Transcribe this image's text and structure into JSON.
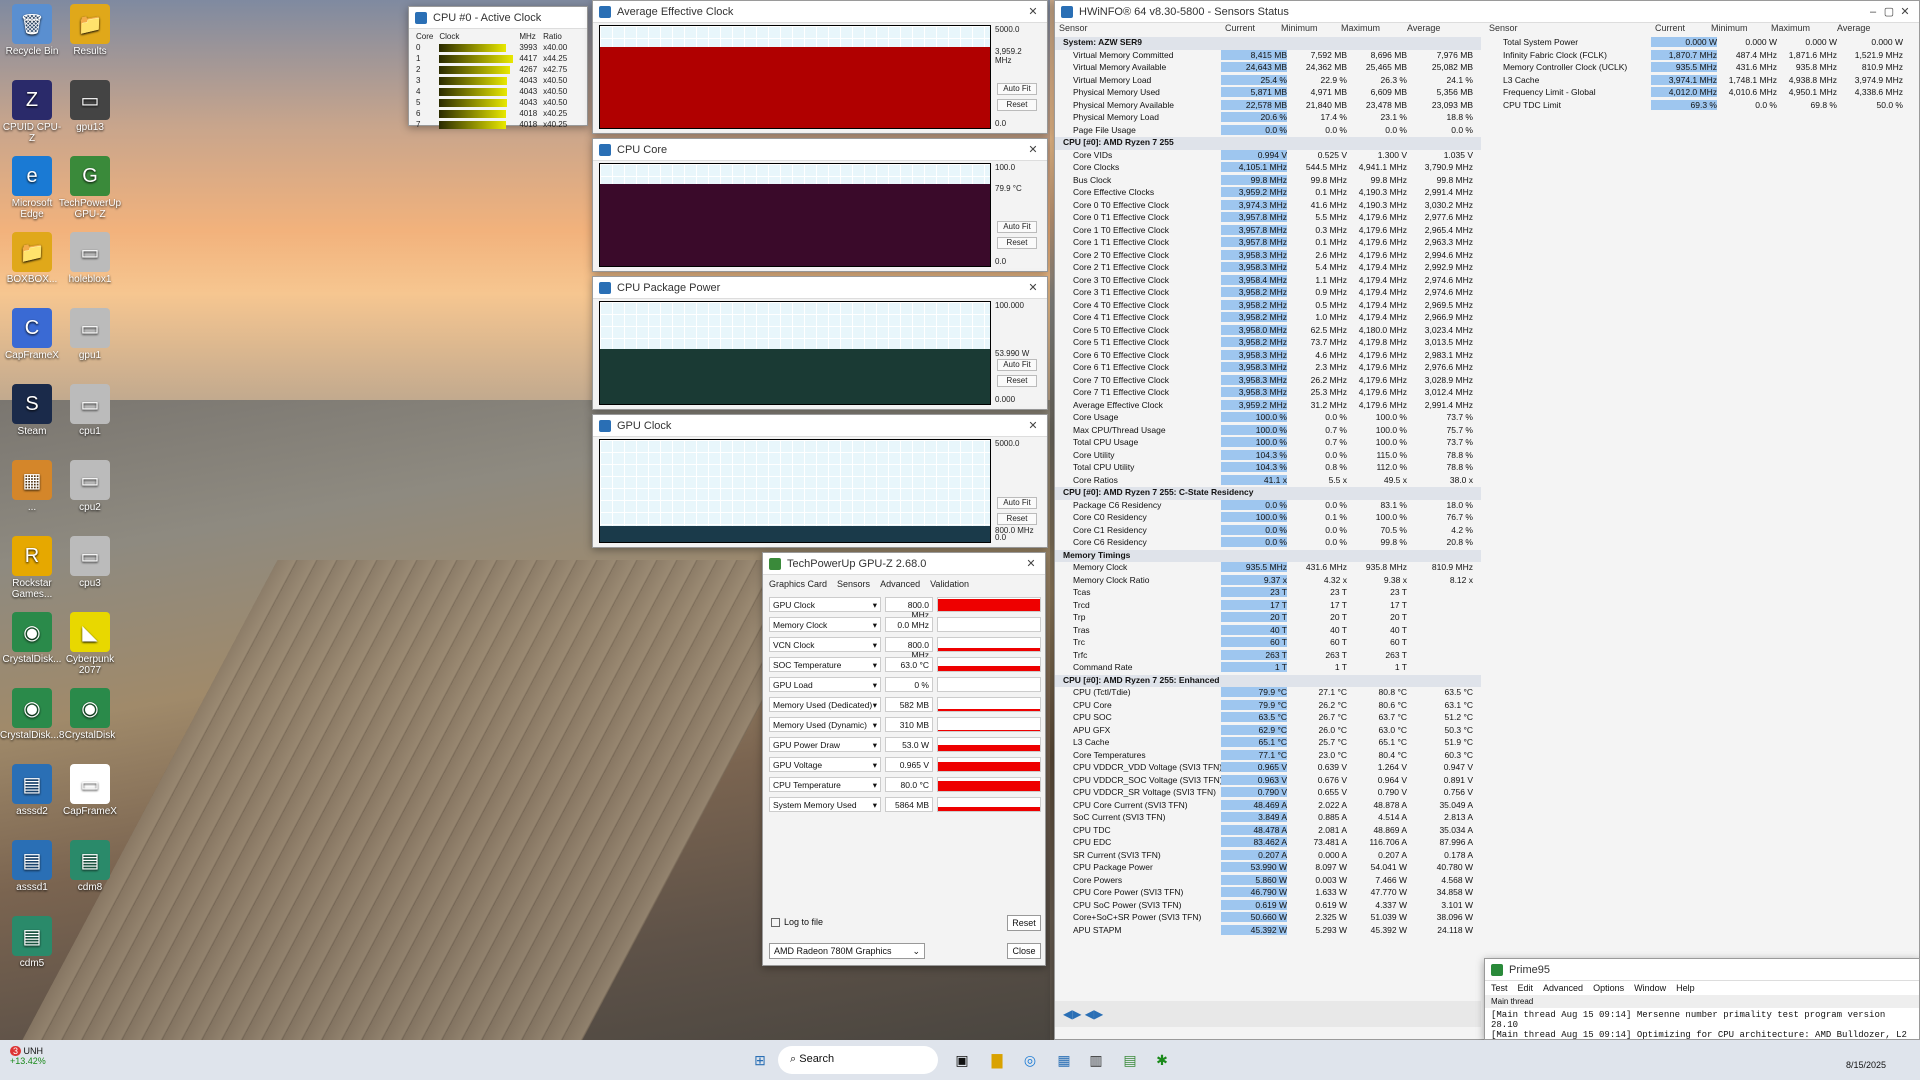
{
  "desktop": {
    "icons": [
      {
        "label": "Recycle Bin",
        "icon": "recycle-bin-icon",
        "glyph": "🗑"
      },
      {
        "label": "Results",
        "icon": "folder-icon",
        "glyph": "📁"
      },
      {
        "label": "CPUID CPU-Z",
        "icon": "cpuz-icon",
        "glyph": "Z"
      },
      {
        "label": "gpu13",
        "icon": "file-icon",
        "glyph": "▭"
      },
      {
        "label": "Microsoft Edge",
        "icon": "edge-icon",
        "glyph": "e"
      },
      {
        "label": "TechPowerUp GPU-Z",
        "icon": "gpuz-icon",
        "glyph": "G"
      },
      {
        "label": "BOXBOX...",
        "icon": "folder-icon",
        "glyph": "📁"
      },
      {
        "label": "holeblox1",
        "icon": "file-icon",
        "glyph": "▭"
      },
      {
        "label": "CapFrameX",
        "icon": "capframex-icon",
        "glyph": "C"
      },
      {
        "label": "gpu1",
        "icon": "file-icon",
        "glyph": "▭"
      },
      {
        "label": "Steam",
        "icon": "steam-icon",
        "glyph": "S"
      },
      {
        "label": "cpu1",
        "icon": "file-icon",
        "glyph": "▭"
      },
      {
        "label": "...",
        "icon": "app-icon",
        "glyph": "▦"
      },
      {
        "label": "cpu2",
        "icon": "file-icon",
        "glyph": "▭"
      },
      {
        "label": "Rockstar Games...",
        "icon": "rockstar-icon",
        "glyph": "R"
      },
      {
        "label": "cpu3",
        "icon": "file-icon",
        "glyph": "▭"
      },
      {
        "label": "CrystalDisk...",
        "icon": "crystaldisk-icon",
        "glyph": "◉"
      },
      {
        "label": "Cyberpunk 2077",
        "icon": "cyberpunk-icon",
        "glyph": "◣"
      },
      {
        "label": "CrystalDisk...8",
        "icon": "crystaldisk-icon",
        "glyph": "◉"
      },
      {
        "label": "CrystalDisk",
        "icon": "crystaldisk-icon",
        "glyph": "◉"
      },
      {
        "label": "asssd2",
        "icon": "asssd-icon",
        "glyph": "▤"
      },
      {
        "label": "CapFrameX",
        "icon": "file-icon",
        "glyph": "▭"
      },
      {
        "label": "asssd1",
        "icon": "asssd-icon",
        "glyph": "▤"
      },
      {
        "label": "cdm8",
        "icon": "cdm-icon",
        "glyph": "▤"
      },
      {
        "label": "cdm5",
        "icon": "cdm-icon",
        "glyph": "▤"
      }
    ]
  },
  "active_clock": {
    "title": "CPU #0 - Active Clock",
    "headers": [
      "Core",
      "Clock",
      "MHz",
      "Ratio"
    ],
    "rows": [
      [
        "0",
        "3993",
        "x40.00"
      ],
      [
        "1",
        "4417",
        "x44.25"
      ],
      [
        "2",
        "4267",
        "x42.75"
      ],
      [
        "3",
        "4043",
        "x40.50"
      ],
      [
        "4",
        "4043",
        "x40.50"
      ],
      [
        "5",
        "4043",
        "x40.50"
      ],
      [
        "6",
        "4018",
        "x40.25"
      ],
      [
        "7",
        "4018",
        "x40.25"
      ]
    ],
    "levels": [
      0.9,
      1.0,
      0.96,
      0.91,
      0.91,
      0.91,
      0.9,
      0.9
    ]
  },
  "graphs": [
    {
      "title": "Average Effective Clock",
      "max": "5000.0",
      "cur": "3,959.2 MHz",
      "min": "0.0",
      "fill": "#b00000",
      "level": 0.79
    },
    {
      "title": "CPU Core",
      "max": "100.0",
      "cur": "79.9 °C",
      "min": "0.0",
      "fill": "#3a0a2a",
      "level": 0.8
    },
    {
      "title": "CPU Package Power",
      "max": "100.000",
      "cur": "53.990 W",
      "min": "0.000",
      "fill": "#1a3a34",
      "level": 0.54
    },
    {
      "title": "GPU Clock",
      "max": "5000.0",
      "cur": "800.0 MHz",
      "min": "0.0",
      "fill": "#1a3a4a",
      "level": 0.16
    }
  ],
  "graph_buttons": {
    "autofit": "Auto Fit",
    "reset": "Reset"
  },
  "gpuz": {
    "title": "TechPowerUp GPU-Z 2.68.0",
    "tabs": [
      "Graphics Card",
      "Sensors",
      "Advanced",
      "Validation"
    ],
    "rows": [
      {
        "name": "GPU Clock",
        "value": "800.0 MHz",
        "level": 0.9
      },
      {
        "name": "Memory Clock",
        "value": "0.0 MHz",
        "level": 0.0
      },
      {
        "name": "VCN Clock",
        "value": "800.0 MHz",
        "level": 0.2
      },
      {
        "name": "SOC Temperature",
        "value": "63.0 °C",
        "level": 0.4
      },
      {
        "name": "GPU Load",
        "value": "0 %",
        "level": 0.0
      },
      {
        "name": "Memory Used (Dedicated)",
        "value": "582 MB",
        "level": 0.15
      },
      {
        "name": "Memory Used (Dynamic)",
        "value": "310 MB",
        "level": 0.1
      },
      {
        "name": "GPU Power Draw",
        "value": "53.0 W",
        "level": 0.5
      },
      {
        "name": "GPU Voltage",
        "value": "0.965 V",
        "level": 0.7
      },
      {
        "name": "CPU Temperature",
        "value": "80.0 °C",
        "level": 0.8
      },
      {
        "name": "System Memory Used",
        "value": "5864 MB",
        "level": 0.3
      }
    ],
    "log": "Log to file",
    "reset": "Reset",
    "device": "AMD Radeon 780M Graphics",
    "close": "Close"
  },
  "hwinfo": {
    "title": "HWiNFO® 64 v8.30-5800 - Sensors Status",
    "headers": [
      "Sensor",
      "Current",
      "Minimum",
      "Maximum",
      "Average"
    ],
    "left": [
      {
        "sec": "System: AZW SER9"
      },
      [
        "Virtual Memory Committed",
        "8,415 MB",
        "7,592 MB",
        "8,696 MB",
        "7,976 MB"
      ],
      [
        "Virtual Memory Available",
        "24,643 MB",
        "24,362 MB",
        "25,465 MB",
        "25,082 MB"
      ],
      [
        "Virtual Memory Load",
        "25.4 %",
        "22.9 %",
        "26.3 %",
        "24.1 %"
      ],
      [
        "Physical Memory Used",
        "5,871 MB",
        "4,971 MB",
        "6,609 MB",
        "5,356 MB"
      ],
      [
        "Physical Memory Available",
        "22,578 MB",
        "21,840 MB",
        "23,478 MB",
        "23,093 MB"
      ],
      [
        "Physical Memory Load",
        "20.6 %",
        "17.4 %",
        "23.1 %",
        "18.8 %"
      ],
      [
        "Page File Usage",
        "0.0 %",
        "0.0 %",
        "0.0 %",
        "0.0 %"
      ],
      {
        "sec": "CPU [#0]: AMD Ryzen 7 255"
      },
      [
        "Core VIDs",
        "0.994 V",
        "0.525 V",
        "1.300 V",
        "1.035 V"
      ],
      [
        "Core Clocks",
        "4,105.1 MHz",
        "544.5 MHz",
        "4,941.1 MHz",
        "3,790.9 MHz"
      ],
      [
        "Bus Clock",
        "99.8 MHz",
        "99.8 MHz",
        "99.8 MHz",
        "99.8 MHz"
      ],
      [
        "Core Effective Clocks",
        "3,959.2 MHz",
        "0.1 MHz",
        "4,190.3 MHz",
        "2,991.4 MHz"
      ],
      [
        "Core 0 T0 Effective Clock",
        "3,974.3 MHz",
        "41.6 MHz",
        "4,190.3 MHz",
        "3,030.2 MHz"
      ],
      [
        "Core 0 T1 Effective Clock",
        "3,957.8 MHz",
        "5.5 MHz",
        "4,179.6 MHz",
        "2,977.6 MHz"
      ],
      [
        "Core 1 T0 Effective Clock",
        "3,957.8 MHz",
        "0.3 MHz",
        "4,179.6 MHz",
        "2,965.4 MHz"
      ],
      [
        "Core 1 T1 Effective Clock",
        "3,957.8 MHz",
        "0.1 MHz",
        "4,179.6 MHz",
        "2,963.3 MHz"
      ],
      [
        "Core 2 T0 Effective Clock",
        "3,958.3 MHz",
        "2.6 MHz",
        "4,179.6 MHz",
        "2,994.6 MHz"
      ],
      [
        "Core 2 T1 Effective Clock",
        "3,958.3 MHz",
        "5.4 MHz",
        "4,179.4 MHz",
        "2,992.9 MHz"
      ],
      [
        "Core 3 T0 Effective Clock",
        "3,958.4 MHz",
        "1.1 MHz",
        "4,179.4 MHz",
        "2,974.6 MHz"
      ],
      [
        "Core 3 T1 Effective Clock",
        "3,958.2 MHz",
        "0.9 MHz",
        "4,179.4 MHz",
        "2,974.6 MHz"
      ],
      [
        "Core 4 T0 Effective Clock",
        "3,958.2 MHz",
        "0.5 MHz",
        "4,179.4 MHz",
        "2,969.5 MHz"
      ],
      [
        "Core 4 T1 Effective Clock",
        "3,958.2 MHz",
        "1.0 MHz",
        "4,179.4 MHz",
        "2,966.9 MHz"
      ],
      [
        "Core 5 T0 Effective Clock",
        "3,958.0 MHz",
        "62.5 MHz",
        "4,180.0 MHz",
        "3,023.4 MHz"
      ],
      [
        "Core 5 T1 Effective Clock",
        "3,958.2 MHz",
        "73.7 MHz",
        "4,179.8 MHz",
        "3,013.5 MHz"
      ],
      [
        "Core 6 T0 Effective Clock",
        "3,958.3 MHz",
        "4.6 MHz",
        "4,179.6 MHz",
        "2,983.1 MHz"
      ],
      [
        "Core 6 T1 Effective Clock",
        "3,958.3 MHz",
        "2.3 MHz",
        "4,179.6 MHz",
        "2,976.6 MHz"
      ],
      [
        "Core 7 T0 Effective Clock",
        "3,958.3 MHz",
        "26.2 MHz",
        "4,179.6 MHz",
        "3,028.9 MHz"
      ],
      [
        "Core 7 T1 Effective Clock",
        "3,958.3 MHz",
        "25.3 MHz",
        "4,179.6 MHz",
        "3,012.4 MHz"
      ],
      [
        "Average Effective Clock",
        "3,959.2 MHz",
        "31.2 MHz",
        "4,179.6 MHz",
        "2,991.4 MHz"
      ],
      [
        "Core Usage",
        "100.0 %",
        "0.0 %",
        "100.0 %",
        "73.7 %"
      ],
      [
        "Max CPU/Thread Usage",
        "100.0 %",
        "0.7 %",
        "100.0 %",
        "75.7 %"
      ],
      [
        "Total CPU Usage",
        "100.0 %",
        "0.7 %",
        "100.0 %",
        "73.7 %"
      ],
      [
        "Core Utility",
        "104.3 %",
        "0.0 %",
        "115.0 %",
        "78.8 %"
      ],
      [
        "Total CPU Utility",
        "104.3 %",
        "0.8 %",
        "112.0 %",
        "78.8 %"
      ],
      [
        "Core Ratios",
        "41.1 x",
        "5.5 x",
        "49.5 x",
        "38.0 x"
      ],
      {
        "sec": "CPU [#0]: AMD Ryzen 7 255: C-State Residency"
      },
      [
        "Package C6 Residency",
        "0.0 %",
        "0.0 %",
        "83.1 %",
        "18.0 %"
      ],
      [
        "Core C0 Residency",
        "100.0 %",
        "0.1 %",
        "100.0 %",
        "76.7 %"
      ],
      [
        "Core C1 Residency",
        "0.0 %",
        "0.0 %",
        "70.5 %",
        "4.2 %"
      ],
      [
        "Core C6 Residency",
        "0.0 %",
        "0.0 %",
        "99.8 %",
        "20.8 %"
      ],
      {
        "sec": "Memory Timings"
      },
      [
        "Memory Clock",
        "935.5 MHz",
        "431.6 MHz",
        "935.8 MHz",
        "810.9 MHz"
      ],
      [
        "Memory Clock Ratio",
        "9.37 x",
        "4.32 x",
        "9.38 x",
        "8.12 x"
      ],
      [
        "Tcas",
        "23 T",
        "23 T",
        "23 T",
        ""
      ],
      [
        "Trcd",
        "17 T",
        "17 T",
        "17 T",
        ""
      ],
      [
        "Trp",
        "20 T",
        "20 T",
        "20 T",
        ""
      ],
      [
        "Tras",
        "40 T",
        "40 T",
        "40 T",
        ""
      ],
      [
        "Trc",
        "60 T",
        "60 T",
        "60 T",
        ""
      ],
      [
        "Trfc",
        "263 T",
        "263 T",
        "263 T",
        ""
      ],
      [
        "Command Rate",
        "1 T",
        "1 T",
        "1 T",
        ""
      ],
      {
        "sec": "CPU [#0]: AMD Ryzen 7 255: Enhanced"
      },
      [
        "CPU (Tctl/Tdie)",
        "79.9 °C",
        "27.1 °C",
        "80.8 °C",
        "63.5 °C"
      ],
      [
        "CPU Core",
        "79.9 °C",
        "26.2 °C",
        "80.6 °C",
        "63.1 °C"
      ],
      [
        "CPU SOC",
        "63.5 °C",
        "26.7 °C",
        "63.7 °C",
        "51.2 °C"
      ],
      [
        "APU GFX",
        "62.9 °C",
        "26.0 °C",
        "63.0 °C",
        "50.3 °C"
      ],
      [
        "L3 Cache",
        "65.1 °C",
        "25.7 °C",
        "65.1 °C",
        "51.9 °C"
      ],
      [
        "Core Temperatures",
        "77.1 °C",
        "23.0 °C",
        "80.4 °C",
        "60.3 °C"
      ],
      [
        "CPU VDDCR_VDD Voltage (SVI3 TFN)",
        "0.965 V",
        "0.639 V",
        "1.264 V",
        "0.947 V"
      ],
      [
        "CPU VDDCR_SOC Voltage (SVI3 TFN)",
        "0.963 V",
        "0.676 V",
        "0.964 V",
        "0.891 V"
      ],
      [
        "CPU VDDCR_SR Voltage (SVI3 TFN)",
        "0.790 V",
        "0.655 V",
        "0.790 V",
        "0.756 V"
      ],
      [
        "CPU Core Current (SVI3 TFN)",
        "48.469 A",
        "2.022 A",
        "48.878 A",
        "35.049 A"
      ],
      [
        "SoC Current (SVI3 TFN)",
        "3.849 A",
        "0.885 A",
        "4.514 A",
        "2.813 A"
      ],
      [
        "CPU TDC",
        "48.478 A",
        "2.081 A",
        "48.869 A",
        "35.034 A"
      ],
      [
        "CPU EDC",
        "83.462 A",
        "73.481 A",
        "116.706 A",
        "87.996 A"
      ],
      [
        "SR Current (SVI3 TFN)",
        "0.207 A",
        "0.000 A",
        "0.207 A",
        "0.178 A"
      ],
      [
        "CPU Package Power",
        "53.990 W",
        "8.097 W",
        "54.041 W",
        "40.780 W"
      ],
      [
        "Core Powers",
        "5.860 W",
        "0.003 W",
        "7.466 W",
        "4.568 W"
      ],
      [
        "CPU Core Power (SVI3 TFN)",
        "46.790 W",
        "1.633 W",
        "47.770 W",
        "34.858 W"
      ],
      [
        "CPU SoC Power (SVI3 TFN)",
        "0.619 W",
        "0.619 W",
        "4.337 W",
        "3.101 W"
      ],
      [
        "Core+SoC+SR Power (SVI3 TFN)",
        "50.660 W",
        "2.325 W",
        "51.039 W",
        "38.096 W"
      ],
      [
        "APU STAPM",
        "45.392 W",
        "5.293 W",
        "45.392 W",
        "24.118 W"
      ]
    ],
    "right": [
      [
        "Total System Power",
        "0.000 W",
        "0.000 W",
        "0.000 W",
        "0.000 W"
      ],
      [
        "Infinity Fabric Clock (FCLK)",
        "1,870.7 MHz",
        "487.4 MHz",
        "1,871.6 MHz",
        "1,521.9 MHz"
      ],
      [
        "Memory Controller Clock (UCLK)",
        "935.5 MHz",
        "431.6 MHz",
        "935.8 MHz",
        "810.9 MHz"
      ],
      [
        "L3 Cache",
        "3,974.1 MHz",
        "1,748.1 MHz",
        "4,938.8 MHz",
        "3,974.9 MHz"
      ],
      [
        "Frequency Limit - Global",
        "4,012.0 MHz",
        "4,010.6 MHz",
        "4,950.1 MHz",
        "4,338.6 MHz"
      ],
      [
        "CPU TDC Limit",
        "69.3 %",
        "0.0 %",
        "69.8 %",
        "50.0 %"
      ]
    ]
  },
  "prime95": {
    "title": "Prime95",
    "menu": [
      "Test",
      "Edit",
      "Advanced",
      "Options",
      "Window",
      "Help"
    ],
    "subtitle": "Main thread",
    "lines": [
      "[Main thread Aug 15 09:14] Mersenne number primality test program version 28.10",
      "[Main thread Aug 15 09:14] Optimizing for CPU architecture: AMD Bulldozer, L2 cache si"
    ]
  },
  "taskbar": {
    "stock": "UNH",
    "change": "+13.42%",
    "search": "Search",
    "date": "8/15/2025",
    "badge": "3"
  }
}
